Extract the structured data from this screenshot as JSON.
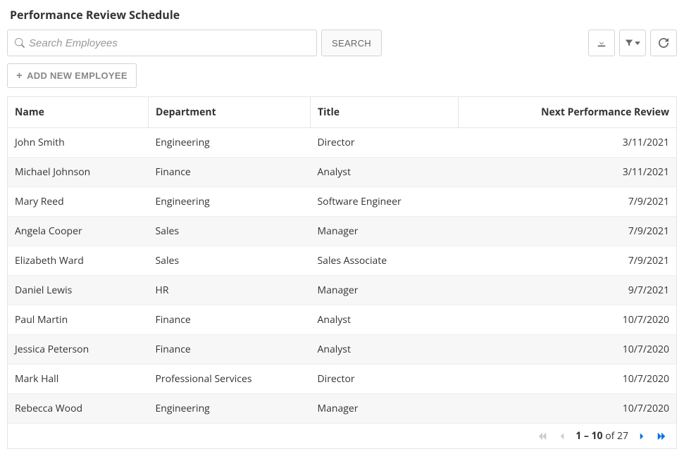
{
  "header": {
    "title": "Performance Review Schedule"
  },
  "search": {
    "placeholder": "Search Employees",
    "value": "",
    "button_label": "SEARCH"
  },
  "toolbar": {
    "download_icon": "download",
    "filter_icon": "filter",
    "refresh_icon": "refresh"
  },
  "actions": {
    "add_employee_label": "ADD NEW EMPLOYEE"
  },
  "table": {
    "columns": {
      "name": "Name",
      "department": "Department",
      "title": "Title",
      "next_review": "Next Performance Review"
    },
    "rows": [
      {
        "name": "John Smith",
        "department": "Engineering",
        "title": "Director",
        "next_review": "3/11/2021"
      },
      {
        "name": "Michael Johnson",
        "department": "Finance",
        "title": "Analyst",
        "next_review": "3/11/2021"
      },
      {
        "name": "Mary Reed",
        "department": "Engineering",
        "title": "Software Engineer",
        "next_review": "7/9/2021"
      },
      {
        "name": "Angela Cooper",
        "department": "Sales",
        "title": "Manager",
        "next_review": "7/9/2021"
      },
      {
        "name": "Elizabeth Ward",
        "department": "Sales",
        "title": "Sales Associate",
        "next_review": "7/9/2021"
      },
      {
        "name": "Daniel Lewis",
        "department": "HR",
        "title": "Manager",
        "next_review": "9/7/2021"
      },
      {
        "name": "Paul Martin",
        "department": "Finance",
        "title": "Analyst",
        "next_review": "10/7/2020"
      },
      {
        "name": "Jessica Peterson",
        "department": "Finance",
        "title": "Analyst",
        "next_review": "10/7/2020"
      },
      {
        "name": "Mark Hall",
        "department": "Professional Services",
        "title": "Director",
        "next_review": "10/7/2020"
      },
      {
        "name": "Rebecca Wood",
        "department": "Engineering",
        "title": "Manager",
        "next_review": "10/7/2020"
      }
    ]
  },
  "pagination": {
    "range": "1 – 10",
    "of_text": "of",
    "total": "27"
  }
}
